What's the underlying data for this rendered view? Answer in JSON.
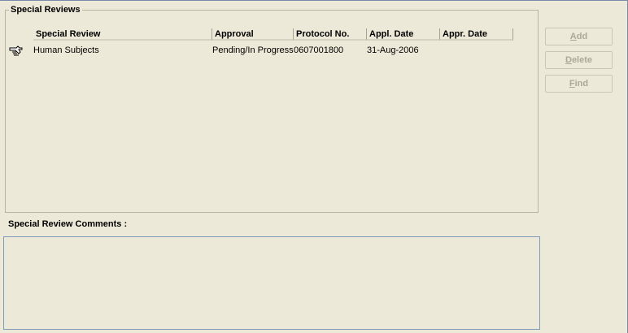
{
  "special_reviews": {
    "title": "Special Reviews",
    "columns": [
      "Special Review",
      "Approval",
      "Protocol No.",
      "Appl. Date",
      "Appr. Date"
    ],
    "rows": [
      {
        "special_review": "Human Subjects",
        "approval": "Pending/In Progress",
        "protocol_no": "0607001800",
        "appl_date": "31-Aug-2006",
        "appr_date": ""
      }
    ]
  },
  "buttons": {
    "add": {
      "mnemonic": "A",
      "rest": "dd"
    },
    "delete": {
      "mnemonic": "D",
      "rest": "elete"
    },
    "find": {
      "mnemonic": "F",
      "rest": "ind"
    }
  },
  "comments": {
    "label": "Special Review Comments :",
    "value": ""
  }
}
